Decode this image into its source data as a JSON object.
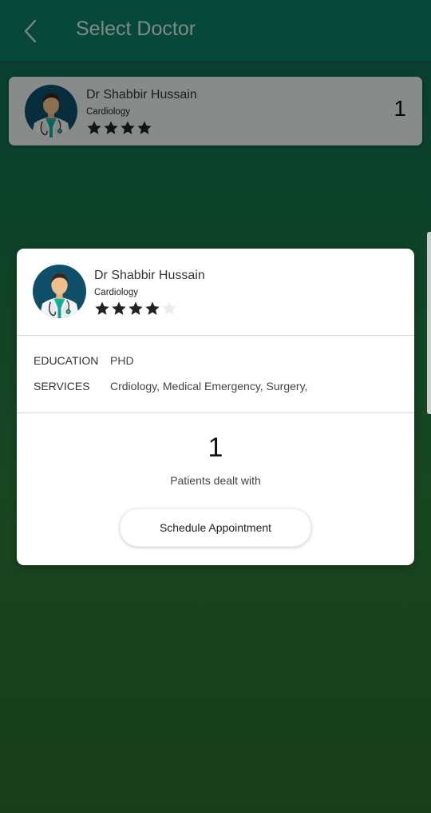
{
  "header": {
    "title": "Select Doctor",
    "back_icon": "chevron-left-icon"
  },
  "doctor_list": [
    {
      "name": "Dr Shabbir Hussain",
      "specialty": "Cardiology",
      "rating": 4,
      "rating_max": 5,
      "count": "1"
    }
  ],
  "doctor_details": {
    "name": "Dr Shabbir Hussain",
    "specialty": "Cardiology",
    "rating": 4,
    "rating_max": 5,
    "education_label": "EDUCATION",
    "education_value": "PHD",
    "services_label": "SERVICES",
    "services_value": "Crdiology, Medical Emergency, Surgery,",
    "patients_count": "1",
    "patients_label": "Patients dealt with",
    "schedule_button": "Schedule Appointment"
  },
  "colors": {
    "star_filled": "#222222",
    "star_empty": "#ececec",
    "avatar_bg": "#0f4f6a"
  }
}
